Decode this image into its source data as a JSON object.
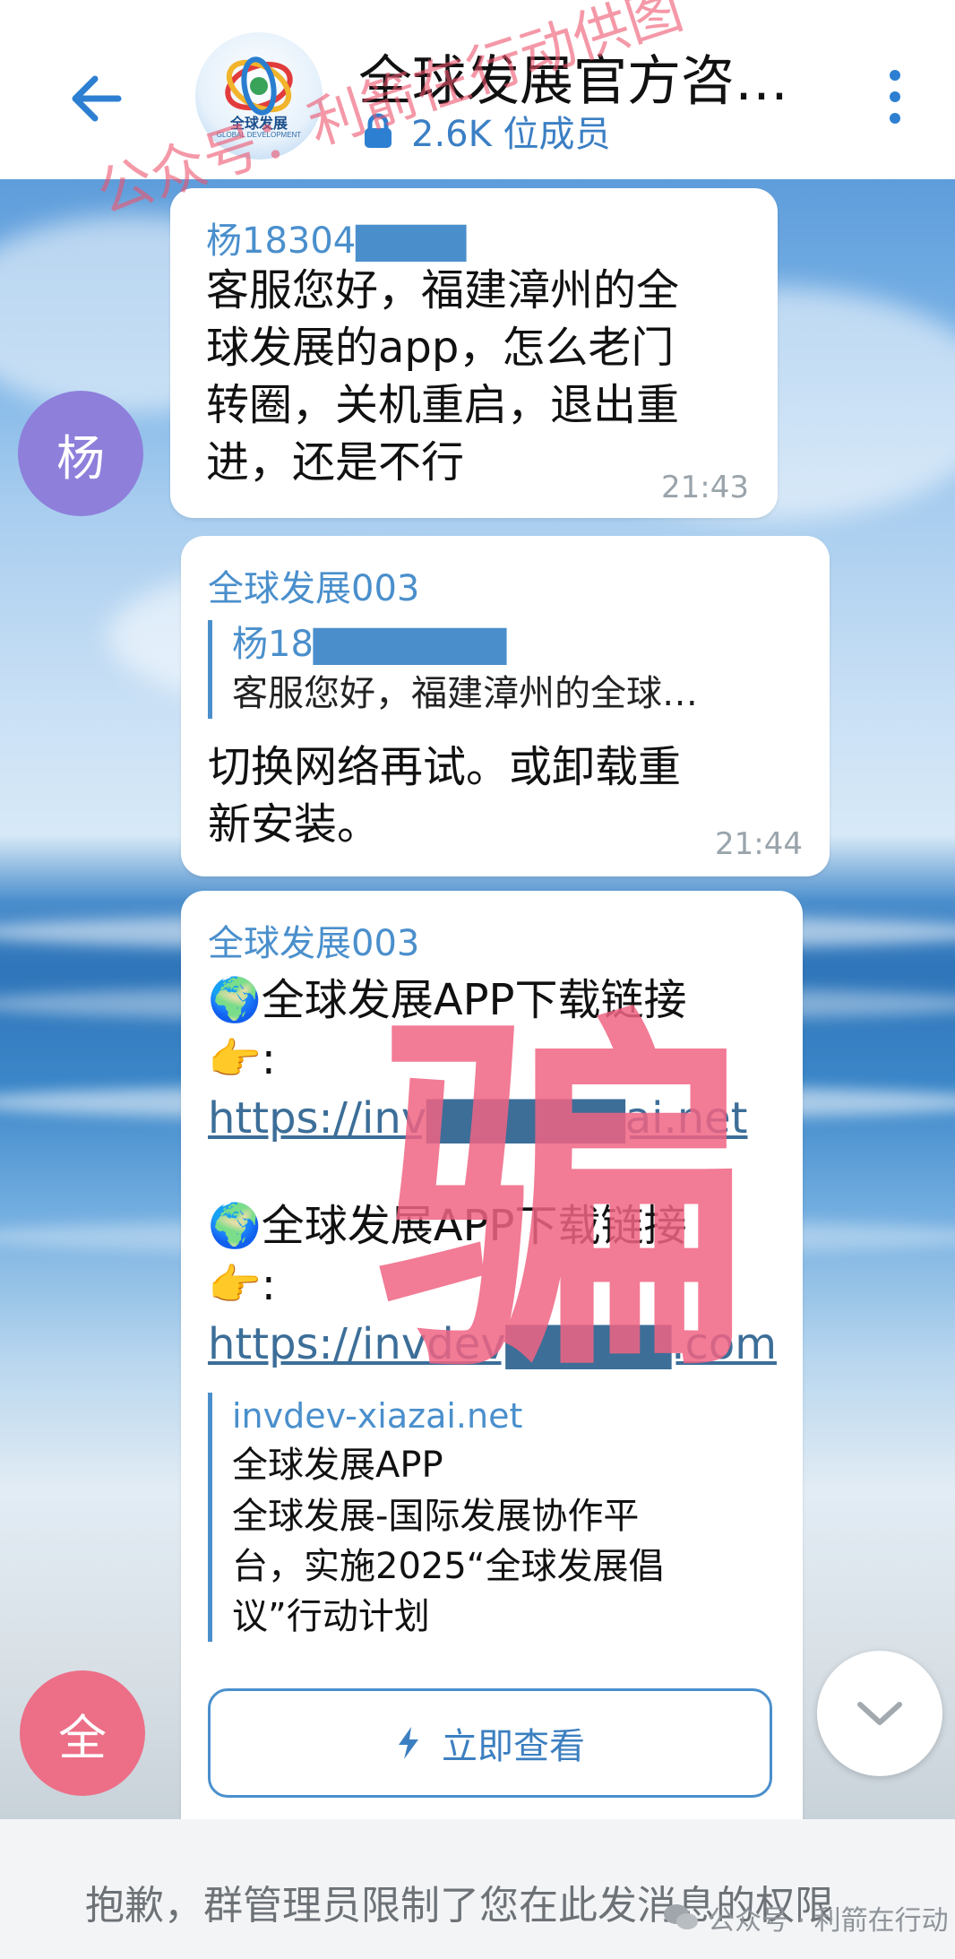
{
  "header": {
    "title": "全球发展官方咨…",
    "members": "2.6K 位成员",
    "logo_text": "全球发展",
    "logo_subtext": "GLOBAL DEVELOPMENT"
  },
  "watermarks": {
    "top_overlay": "公众号：利箭在行动供图",
    "big_overlay": "骗",
    "footer": "公众号 · 利箭在行动"
  },
  "messages": [
    {
      "avatar_letter": "杨",
      "avatar_color": "#8e7fdb",
      "sender": "杨18304▇▇▇▇",
      "text": [
        "客服您好，福建漳州的全",
        "球发展的app，怎么老门",
        "转圈，关机重启，退出重",
        "进，还是不行"
      ],
      "time": "21:43"
    },
    {
      "sender": "全球发展003",
      "reply_name": "杨18▇▇▇▇▇▇▇",
      "reply_text": "客服您好，福建漳州的全球…",
      "text": [
        "切换网络再试。或卸载重",
        "新安装。"
      ],
      "time": "21:44"
    },
    {
      "sender": "全球发展003",
      "avatar_letter": "全",
      "avatar_color": "#ec6f87",
      "lines": [
        {
          "emoji": "🌍",
          "text": "全球发展APP下载链接"
        },
        {
          "emoji": "👉",
          "text": ":"
        },
        {
          "link": "https://inv▇▇▇▇▇▇ai.net"
        },
        {
          "emoji": "🌍",
          "text": "全球发展APP下载链接"
        },
        {
          "emoji": "👉",
          "text": ":"
        },
        {
          "link": "https://invdev▇▇▇▇▇.com"
        }
      ],
      "preview": {
        "site": "invdev-xiazai.net",
        "title": "全球发展APP",
        "desc": [
          "全球发展-国际发展协作平",
          "台，实施2025“全球发展倡",
          "议”行动计划"
        ]
      },
      "button_label": "立即查看"
    }
  ],
  "bottom_bar": {
    "restriction_text": "抱歉，群管理员限制了您在此发消息的权限"
  },
  "colors": {
    "accent": "#2d7fd1",
    "link": "#4a8fcc",
    "watermark": "#ec546d"
  },
  "icons": [
    "back-arrow-icon",
    "lock-icon",
    "more-vertical-icon",
    "globe-emoji-icon",
    "pointing-hand-emoji-icon",
    "lightning-icon",
    "chevron-down-icon",
    "wechat-icon"
  ]
}
